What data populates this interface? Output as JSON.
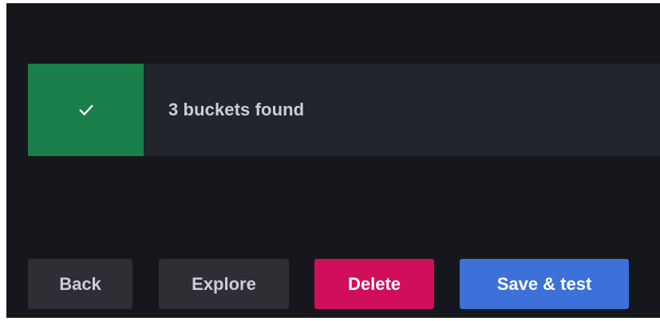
{
  "alert": {
    "status": "success",
    "icon": "check-icon",
    "message": "3 buckets found",
    "accent_color": "#1a7f4b"
  },
  "actions": {
    "back_label": "Back",
    "explore_label": "Explore",
    "delete_label": "Delete",
    "save_test_label": "Save & test"
  },
  "colors": {
    "background": "#16171c",
    "alert_background": "#22252b",
    "secondary_button": "#2d2f34",
    "destructive_button": "#d10e5c",
    "primary_button": "#3d71d9"
  }
}
